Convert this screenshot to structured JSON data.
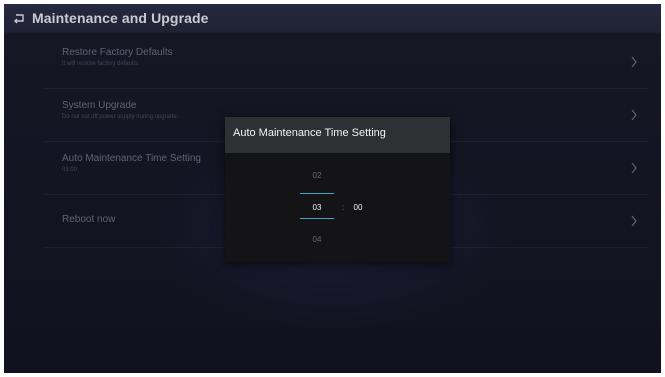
{
  "header": {
    "title": "Maintenance and Upgrade",
    "back_icon": "back-arrow-icon"
  },
  "menu": {
    "items": [
      {
        "title": "Restore Factory Defaults",
        "subtitle": "It will restore factory defaults"
      },
      {
        "title": "System Upgrade",
        "subtitle": "Do not cut off power supply during upgrade."
      },
      {
        "title": "Auto Maintenance Time Setting",
        "subtitle": "03:00"
      },
      {
        "title": "Reboot now",
        "subtitle": ""
      }
    ],
    "chevron_icon": "chevron-right-icon"
  },
  "dialog": {
    "title": "Auto Maintenance Time Setting",
    "hour_prev": "02",
    "hour_selected": "03",
    "hour_next": "04",
    "separator": ":",
    "minute_selected": "00"
  },
  "colors": {
    "accent": "#3aa6c8",
    "title_bar": "#2c2f48",
    "dialog_header": "#2f3033"
  }
}
